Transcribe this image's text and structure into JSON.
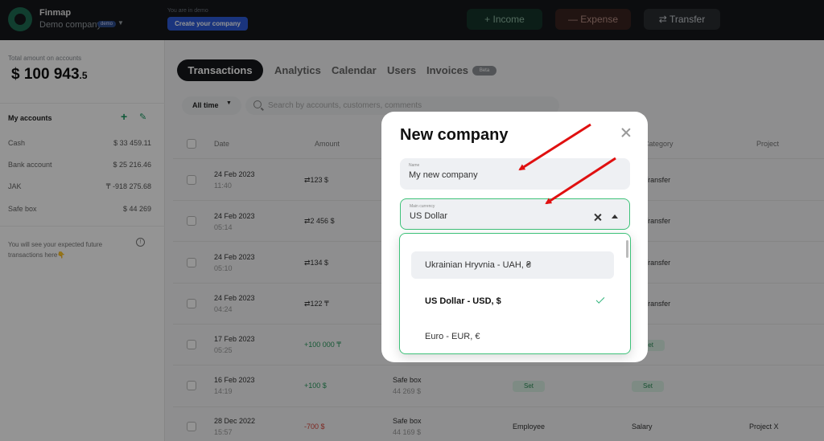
{
  "header": {
    "app_name": "Finmap",
    "company_name": "Demo company",
    "company_badge": "demo",
    "demo_note": "You are in demo",
    "create_company": "Create your company",
    "income": "+ Income",
    "expense": "— Expense",
    "transfer": "⇄ Transfer"
  },
  "sidebar": {
    "total_label": "Total amount on accounts",
    "total_main": "$ 100 943",
    "total_decimal": ".5",
    "my_accounts": "My accounts",
    "accounts": [
      {
        "name": "Cash",
        "amount": "$ 33 459.11"
      },
      {
        "name": "Bank account",
        "amount": "$ 25 216.46"
      },
      {
        "name": "JAK",
        "amount": "₸ -918 275.68"
      },
      {
        "name": "Safe box",
        "amount": "$ 44 269"
      }
    ],
    "future_note": "You will see your expected future transactions here👇"
  },
  "tabs": {
    "transactions": "Transactions",
    "analytics": "Analytics",
    "calendar": "Calendar",
    "users": "Users",
    "invoices": "Invoices",
    "beta": "Beta"
  },
  "filters": {
    "period": "All time",
    "search_placeholder": "Search by accounts, customers, comments"
  },
  "table": {
    "headers": {
      "date": "Date",
      "amount": "Amount",
      "category": "Category",
      "project": "Project"
    },
    "rows": [
      {
        "date": "24 Feb 2023",
        "time": "11:40",
        "amount": "⇄123 $",
        "account": "",
        "account_sub": "",
        "counterparty": "",
        "category": "Transfer",
        "project": ""
      },
      {
        "date": "24 Feb 2023",
        "time": "05:14",
        "amount": "⇄2 456 $",
        "account": "",
        "account_sub": "",
        "counterparty": "",
        "category": "Transfer",
        "project": ""
      },
      {
        "date": "24 Feb 2023",
        "time": "05:10",
        "amount": "⇄134 $",
        "account": "",
        "account_sub": "",
        "counterparty": "",
        "category": "Transfer",
        "project": ""
      },
      {
        "date": "24 Feb 2023",
        "time": "04:24",
        "amount": "⇄122 ₸",
        "account": "",
        "account_sub": "",
        "counterparty": "",
        "category": "Transfer",
        "project": ""
      },
      {
        "date": "17 Feb 2023",
        "time": "05:25",
        "amount": "+100 000 ₸",
        "account": "",
        "account_sub": "",
        "counterparty": "",
        "category": "Set",
        "project": ""
      },
      {
        "date": "16 Feb 2023",
        "time": "14:19",
        "amount": "+100 $",
        "account": "Safe box",
        "account_sub": "44 269 $",
        "counterparty": "Set",
        "category": "Set",
        "project": ""
      },
      {
        "date": "28 Dec 2022",
        "time": "15:57",
        "amount": "-700 $",
        "account": "Safe box",
        "account_sub": "44 169 $",
        "counterparty": "Employee",
        "category": "Salary",
        "project": "Project X"
      }
    ]
  },
  "modal": {
    "title": "New company",
    "name_label": "Name",
    "name_value": "My new company",
    "currency_label": "Main currency",
    "currency_value": "US Dollar",
    "options": [
      "Ukrainian Hryvnia - UAH, ₴",
      "US Dollar - USD, $",
      "Euro - EUR, €"
    ]
  },
  "colors": {
    "accent_green": "#2fb37a",
    "arrow_red": "#e01010",
    "dark_bg": "#15171a"
  }
}
